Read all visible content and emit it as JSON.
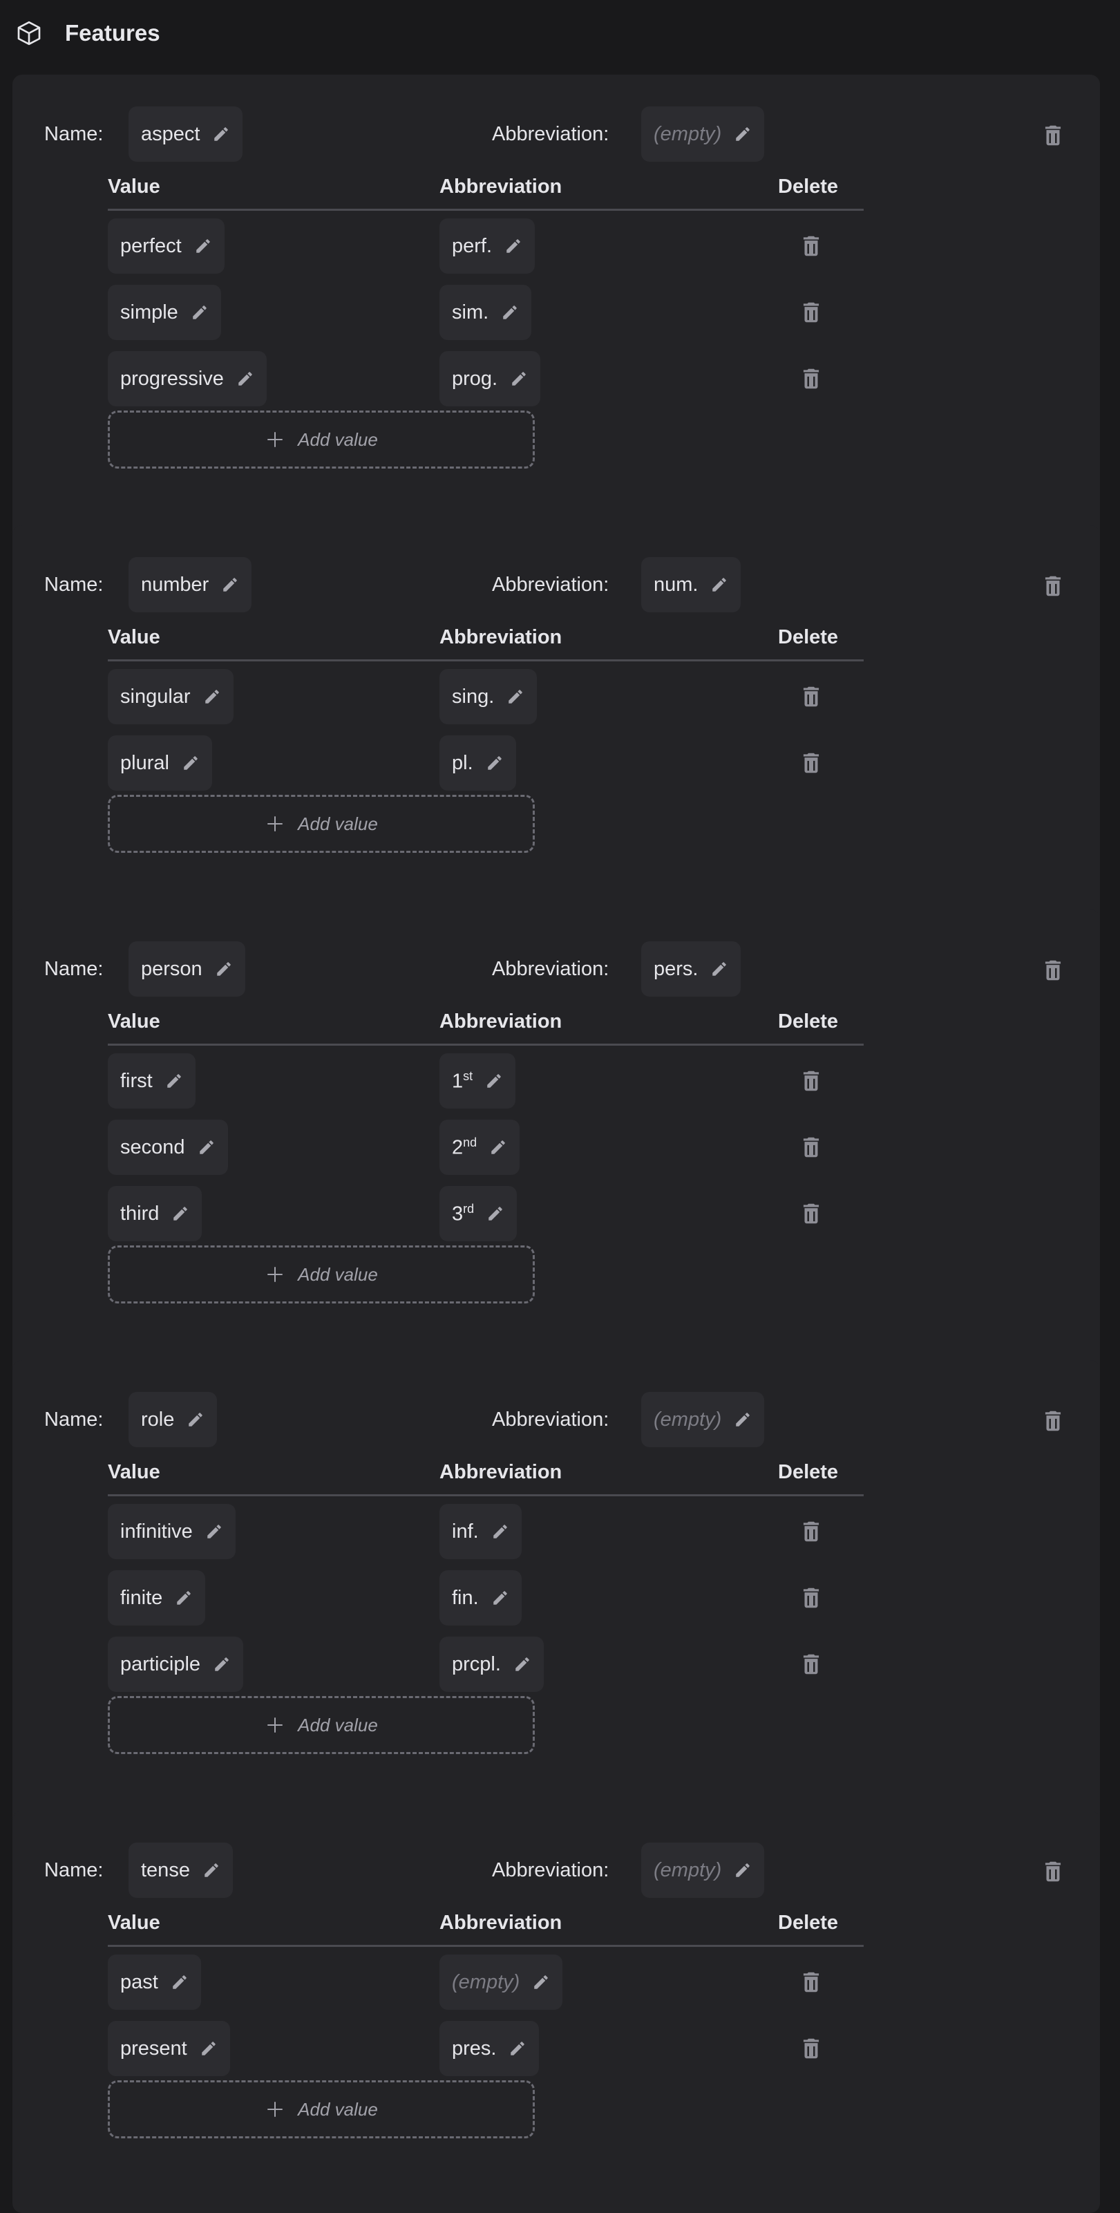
{
  "header": {
    "title": "Features",
    "icon": "cube-icon"
  },
  "labels": {
    "name": "Name:",
    "abbreviation": "Abbreviation:",
    "col_value": "Value",
    "col_abbreviation": "Abbreviation",
    "col_delete": "Delete",
    "add_value": "Add value",
    "empty": "(empty)"
  },
  "colors": {
    "background": "#19191b",
    "card": "#232326",
    "chip": "#2c2c30",
    "icon": "#8e8e96",
    "text": "#e6e6ea",
    "muted": "#7c7c84"
  },
  "features": [
    {
      "name": "aspect",
      "abbreviation": "",
      "values": [
        {
          "value": "perfect",
          "abbr": "perf."
        },
        {
          "value": "simple",
          "abbr": "sim."
        },
        {
          "value": "progressive",
          "abbr": "prog."
        }
      ]
    },
    {
      "name": "number",
      "abbreviation": "num.",
      "values": [
        {
          "value": "singular",
          "abbr": "sing."
        },
        {
          "value": "plural",
          "abbr": "pl."
        }
      ]
    },
    {
      "name": "person",
      "abbreviation": "pers.",
      "values": [
        {
          "value": "first",
          "abbr": "1",
          "abbr_sup": "st"
        },
        {
          "value": "second",
          "abbr": "2",
          "abbr_sup": "nd"
        },
        {
          "value": "third",
          "abbr": "3",
          "abbr_sup": "rd"
        }
      ]
    },
    {
      "name": "role",
      "abbreviation": "",
      "values": [
        {
          "value": "infinitive",
          "abbr": "inf."
        },
        {
          "value": "finite",
          "abbr": "fin."
        },
        {
          "value": "participle",
          "abbr": "prcpl."
        }
      ]
    },
    {
      "name": "tense",
      "abbreviation": "",
      "values": [
        {
          "value": "past",
          "abbr": ""
        },
        {
          "value": "present",
          "abbr": "pres."
        }
      ]
    }
  ]
}
